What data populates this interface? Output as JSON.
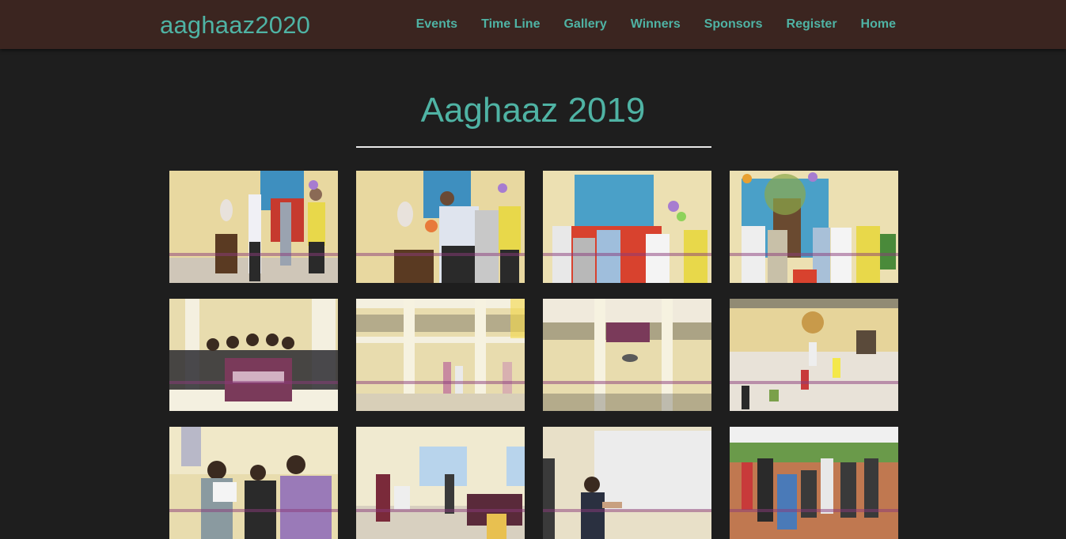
{
  "navbar": {
    "brand": "aaghaaz2020",
    "links": [
      "Events",
      "Time Line",
      "Gallery",
      "Winners",
      "Sponsors",
      "Register",
      "Home"
    ]
  },
  "gallery": {
    "title": "Aaghaaz 2019",
    "photos": [
      "inauguration-lamp-lighting",
      "inauguration-lamp-lighting-closeup",
      "inauguration-banner-unveiling",
      "inauguration-guests-group",
      "students-with-aaghaaz-banner",
      "college-courtyard-balcony",
      "balcony-banner-students",
      "courtyard-sports-game",
      "students-registration-desk",
      "seminar-room-event",
      "student-presentation",
      "outdoor-ground-activity"
    ]
  },
  "colors": {
    "accent": "#4fb3a4",
    "navbar_bg": "#3b2520",
    "page_bg": "#1e1e1e"
  }
}
